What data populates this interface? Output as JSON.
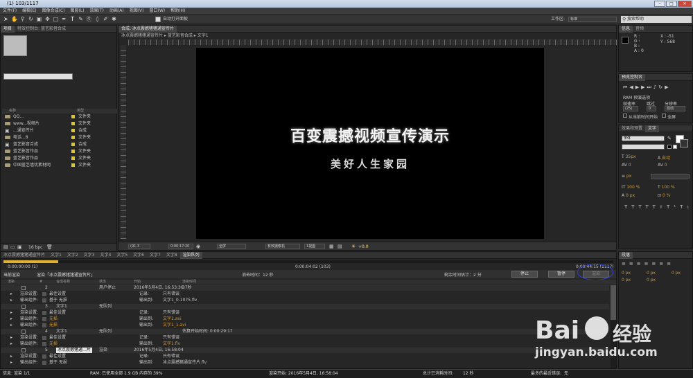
{
  "window": {
    "title": "(1) 103/1117"
  },
  "menu": [
    "文件(F)",
    "编辑(E)",
    "图像合成(C)",
    "图层(L)",
    "效果(T)",
    "动画(A)",
    "视图(V)",
    "窗口(W)",
    "帮助(H)"
  ],
  "toolbar": {
    "auto_open": "自动打开面板",
    "workspace_label": "工作区:",
    "workspace_value": "标准",
    "search_placeholder": "搜索帮助"
  },
  "project": {
    "tabs": [
      "项目",
      "特效控制台: 蓝艺影音合成"
    ],
    "col_name": "名称",
    "col_type": "类型",
    "items": [
      {
        "name": "QQ...",
        "type": "文件夹",
        "kind": "folder"
      },
      {
        "name": "www...视频片",
        "type": "文件夹",
        "kind": "folder"
      },
      {
        "name": "...通宣传片",
        "type": "合成",
        "kind": "comp"
      },
      {
        "name": "电话...8",
        "type": "文件夹",
        "kind": "folder"
      },
      {
        "name": "蓝艺影音合成",
        "type": "合成",
        "kind": "comp"
      },
      {
        "name": "蓝艺影音作品",
        "type": "文件夹",
        "kind": "folder"
      },
      {
        "name": "蓝艺影音作品",
        "type": "文件夹",
        "kind": "folder"
      },
      {
        "name": "中国蓝艺墙优素材网",
        "type": "文件夹",
        "kind": "folder"
      }
    ],
    "bpc": "16 bpc"
  },
  "comp": {
    "tab": "合成: 冰点震撼猪猪通宣传片",
    "breadcrumb": [
      "冰点震撼猪猪通宣传片",
      "蓝艺影音合成",
      "文字1"
    ],
    "title": "百变震撼视频宣传演示",
    "subtitle": "美好人生家园",
    "zoom": "(91.3",
    "timecode": "0:00:17:20",
    "res": "全屏",
    "camera": "有效摄像机",
    "views": "1视图",
    "offset": "+0.0"
  },
  "info": {
    "tabs": [
      "信息",
      "音频"
    ],
    "r": "R :",
    "g": "G :",
    "b": "B :",
    "a": "A : 0",
    "x": "X : -51",
    "y": "Y : 568"
  },
  "preview": {
    "title": "预览控制台",
    "ram": "RAM 预演选项",
    "fps_label": "帧速率",
    "skip_label": "跳过",
    "res_label": "分辨率",
    "fps": "(25)",
    "skip": "0",
    "res": "自动",
    "from_current": "从当前时间开始",
    "full": "全屏"
  },
  "char": {
    "tabs": [
      "效果和预置",
      "文字"
    ],
    "font": "宋体",
    "size": "35px",
    "leading": "自动",
    "tracking": "0",
    "px": "px",
    "scale1": "100 %",
    "scale2": "100 %",
    "base": "0 px",
    "tsume": "0 %"
  },
  "para": {
    "title": "段落",
    "px": "0 px"
  },
  "timeline": {
    "tabs": [
      "冰点震撼猪猪通宣传片",
      "文字1",
      "文字2",
      "文字3",
      "文字4",
      "文字5",
      "文字6",
      "文字7",
      "文字8",
      "渲染队列"
    ],
    "t_start": "0:00:00:00 (1)",
    "t_mid": "0:00:04:02 (103)",
    "t_end": "0:00:44:15 (1117)",
    "current_label": "当前渲染",
    "rendering": "渲染「冰点震撼猪猪通宣传片」",
    "elapsed": "消去时间：12 秒",
    "remain": "剩余时间估计：2 分",
    "stop": "停止",
    "pause": "暂停",
    "render": "渲染",
    "cols": [
      "渲染",
      "#",
      "合成名称",
      "状态",
      "开始",
      "渲染时间"
    ],
    "rows": [
      {
        "n": "2",
        "name": "",
        "status": "用户停止",
        "start": "2016年5月4日, 16:53:36",
        "time": "37秒",
        "head": true
      },
      {
        "a": "渲染设置:",
        "b": "最佳设置",
        "c": "记录:",
        "d": "只有错误"
      },
      {
        "a": "输出组件:",
        "b": "基于 无损",
        "c": "输出到:",
        "d": "文字1_0-1075.flv"
      },
      {
        "n": "3",
        "name": "文字1",
        "status": "无队列",
        "head": true
      },
      {
        "a": "渲染设置:",
        "b": "最佳设置",
        "c": "记录:",
        "d": "只有错误"
      },
      {
        "a": "输出组件:",
        "b": "无损",
        "c": "输出到:",
        "d": "文字1.avi"
      },
      {
        "a": "输出组件:",
        "b": "无损",
        "c": "输出到:",
        "d": "文字1_1.avi"
      },
      {
        "n": "4",
        "name": "文字1",
        "status": "无队列",
        "start": "",
        "time": "估算开始时间: 0:00:29:17",
        "head": true
      },
      {
        "a": "渲染设置:",
        "b": "最佳设置",
        "c": "记录:",
        "d": "只有错误"
      },
      {
        "a": "输出组件:",
        "b": "无损",
        "c": "输出到:",
        "d": "文字1.flv"
      },
      {
        "n": "5",
        "name": "冰点震撼猪通...片",
        "status": "渲染",
        "start": "2016年5月4日, 16:58:04",
        "head": true
      },
      {
        "a": "渲染设置:",
        "b": "最佳设置",
        "c": "记录:",
        "d": "只有错误"
      },
      {
        "a": "输出组件:",
        "b": "基于 无损",
        "c": "输出到:",
        "d": "冰点震撼猪通宣传片.flv"
      }
    ]
  },
  "status": {
    "info": "信息: 渲染 1/1",
    "ram": "RAM: 已使用全部 1.9 GB 内存的 39%",
    "render_start": "渲染开始: 2016年5月4日, 16:58:04",
    "total_label": "总计已消耗时间:",
    "total": "12 秒",
    "recent_label": "最多的最近错误:",
    "recent": "无"
  },
  "watermark": {
    "brand": "Bai",
    "brand2": "经验",
    "url": "jingyan.baidu.com"
  }
}
